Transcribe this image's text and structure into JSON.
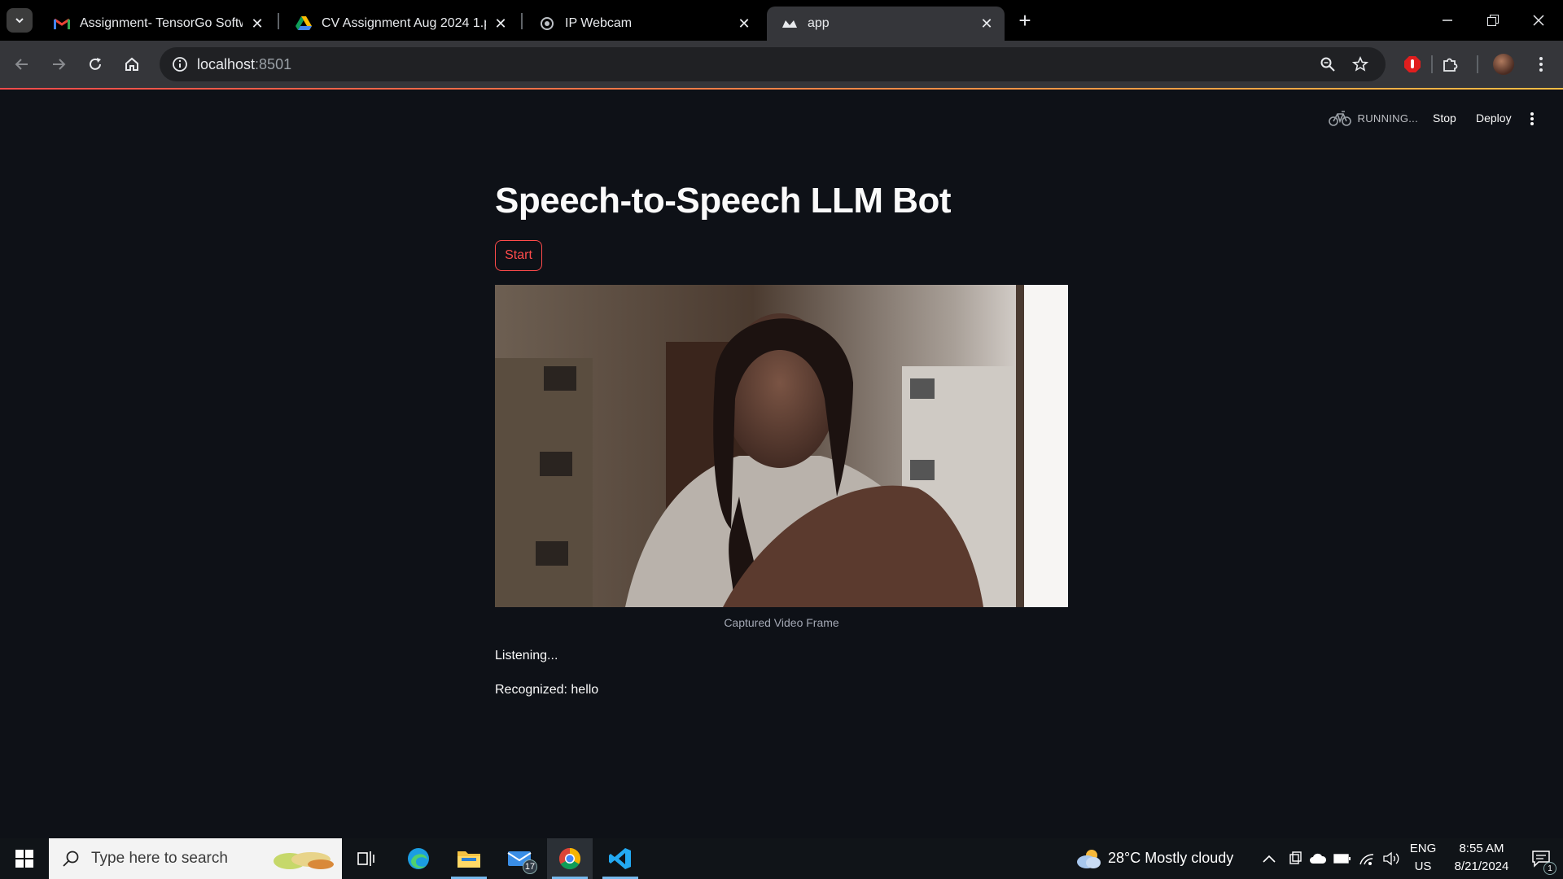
{
  "browser": {
    "tabs": [
      {
        "title": "Assignment- TensorGo Software",
        "icon": "gmail-icon"
      },
      {
        "title": "CV Assignment Aug 2024 1.pdf",
        "icon": "drive-icon"
      },
      {
        "title": "IP Webcam",
        "icon": "globe-icon"
      },
      {
        "title": "app",
        "icon": "streamlit-icon",
        "active": true
      }
    ],
    "url_host": "localhost",
    "url_port": ":8501"
  },
  "streamlit_header": {
    "status": "RUNNING...",
    "stop_label": "Stop",
    "deploy_label": "Deploy"
  },
  "main": {
    "title": "Speech-to-Speech LLM Bot",
    "start_label": "Start",
    "image_caption": "Captured Video Frame",
    "status_listening": "Listening...",
    "status_recognized": "Recognized: hello"
  },
  "taskbar": {
    "search_placeholder": "Type here to search",
    "mail_badge": "17",
    "weather": "28°C  Mostly cloudy",
    "lang_top": "ENG",
    "lang_bottom": "US",
    "time": "8:55 AM",
    "date": "8/21/2024",
    "notif_count": "1"
  },
  "colors": {
    "accent": "#ff4b4b",
    "page_bg": "#0e1117",
    "chrome_bg": "#35363a"
  }
}
